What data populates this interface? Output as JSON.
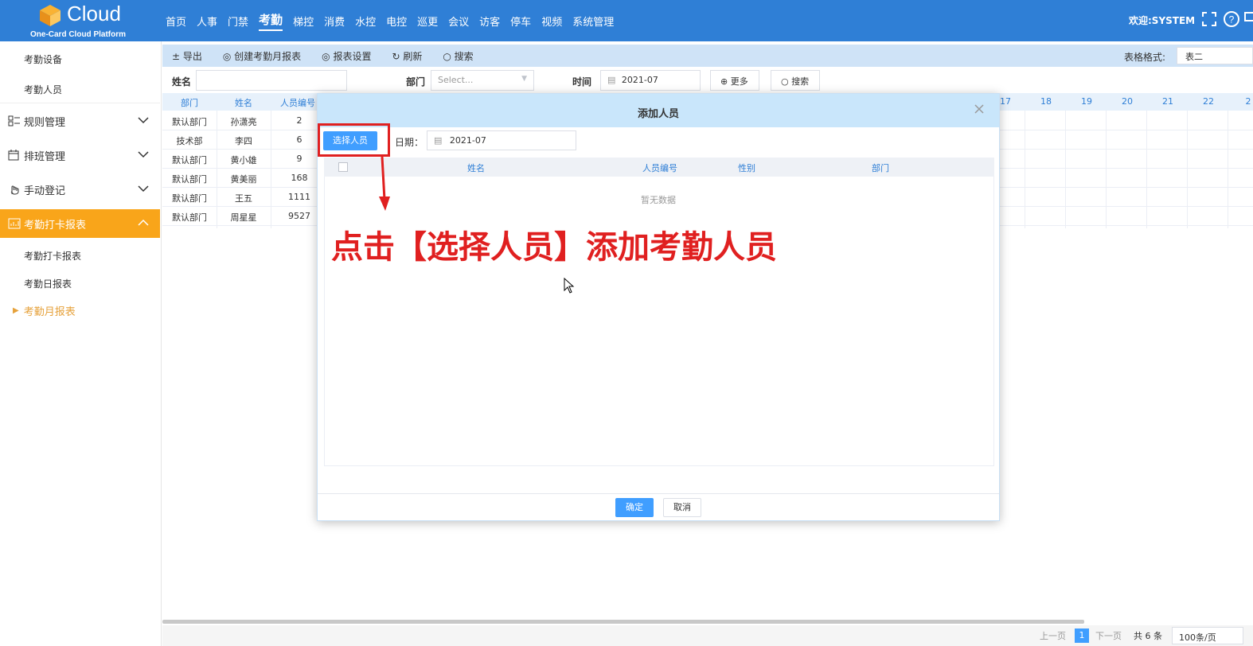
{
  "header": {
    "logo_text": "Cloud",
    "logo_sub": "One-Card Cloud Platform",
    "nav": [
      "首页",
      "人事",
      "门禁",
      "考勤",
      "梯控",
      "消费",
      "水控",
      "电控",
      "巡更",
      "会议",
      "访客",
      "停车",
      "视频",
      "系统管理"
    ],
    "active_nav": "考勤",
    "welcome": "欢迎:SYSTEM"
  },
  "sidebar": {
    "items": [
      {
        "label": "考勤设备"
      },
      {
        "label": "考勤人员"
      },
      {
        "label": "规则管理"
      },
      {
        "label": "排班管理"
      },
      {
        "label": "手动登记"
      },
      {
        "label": "考勤打卡报表"
      },
      {
        "label": "考勤打卡报表"
      },
      {
        "label": "考勤日报表"
      },
      {
        "label": "考勤月报表"
      }
    ]
  },
  "toolbar": {
    "export": "± 导出",
    "create": "◎ 创建考勤月报表",
    "settings": "◎ 报表设置",
    "refresh": "↻ 刷新",
    "search": "○ 搜索",
    "format_label": "表格格式:",
    "format_value": "表二"
  },
  "filter": {
    "name_label": "姓名",
    "dept_label": "部门",
    "dept_placeholder": "Select...",
    "time_label": "时间",
    "time_value": "2021-07",
    "more": "⊕ 更多",
    "search": "○ 搜索"
  },
  "grid": {
    "headers": [
      "部门",
      "姓名",
      "人员编号"
    ],
    "day_headers": [
      "17",
      "18",
      "19",
      "20",
      "21",
      "22",
      "2"
    ],
    "rows": [
      [
        "默认部门",
        "孙潇亮",
        "2"
      ],
      [
        "技术部",
        "李四",
        "6"
      ],
      [
        "默认部门",
        "黄小雄",
        "9"
      ],
      [
        "默认部门",
        "黄美丽",
        "168"
      ],
      [
        "默认部门",
        "王五",
        "1111"
      ],
      [
        "默认部门",
        "周星星",
        "9527"
      ]
    ]
  },
  "modal": {
    "title": "添加人员",
    "select_button": "选择人员",
    "date_label": "日期：",
    "date_value": "2021-07",
    "columns": [
      "姓名",
      "人员编号",
      "性别",
      "部门"
    ],
    "empty": "暂无数据",
    "ok": "确定",
    "cancel": "取消"
  },
  "annotation": "点击【选择人员】添加考勤人员",
  "pager": {
    "prev": "上一页",
    "page": "1",
    "next": "下一页",
    "total": "共 6 条",
    "size": "100条/页"
  },
  "colors": {
    "header": "#2f7fd6",
    "accent": "#f9a51a",
    "primary": "#409eff",
    "annotation": "#e02020"
  }
}
